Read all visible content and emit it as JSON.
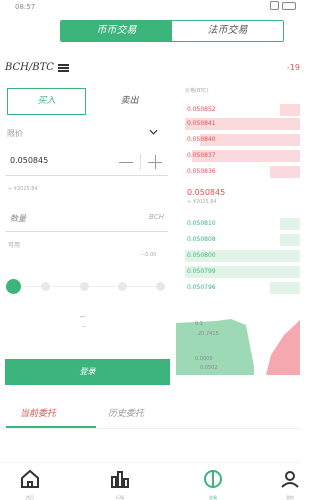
{
  "status": {
    "time": "08:57"
  },
  "tabs": [
    {
      "label": "币币交易",
      "active": true
    },
    {
      "label": "法币交易",
      "active": false
    }
  ],
  "pair": {
    "symbol": "BCH/BTC",
    "change": "-19"
  },
  "form": {
    "buy_label": "买入",
    "sell_label": "卖出",
    "order_type_label": "限价",
    "price_value": "0.050845",
    "approx_value": "≈ ¥2025.84",
    "quantity_placeholder": "数量",
    "quantity_unit": "BCH",
    "available_label": "可用",
    "available_value": "--.0.00",
    "total_label": "--",
    "total_sub": "--",
    "submit_label": "登录"
  },
  "orderbook": {
    "header": "价格(BTC)",
    "asks": [
      "0.050852",
      "0.050841",
      "0.050840",
      "0.050837",
      "0.050836"
    ],
    "mid_price": "0.050845",
    "mid_sub": "≈ ¥2025.84",
    "bids": [
      "0.050810",
      "0.050808",
      "0.050800",
      "0.050799",
      "0.050796"
    ]
  },
  "depth": {
    "label_top": "0.1",
    "label_mid": "20.7415",
    "label_bottom": "0.0000",
    "label_axis": "0.0502"
  },
  "order_tabs": [
    {
      "label": "当前委托",
      "active": true
    },
    {
      "label": "历史委托",
      "active": false
    }
  ],
  "nav": [
    {
      "label": "首页",
      "icon": "home-icon"
    },
    {
      "label": "行情",
      "icon": "chart-icon"
    },
    {
      "label": "交易",
      "icon": "trade-icon"
    },
    {
      "label": "我的",
      "icon": "user-icon"
    }
  ],
  "colors": {
    "accent": "#3cb57c",
    "sell": "#e94e4e",
    "ask_bg": "#fadadd",
    "bid_bg": "#e2f4e8"
  }
}
